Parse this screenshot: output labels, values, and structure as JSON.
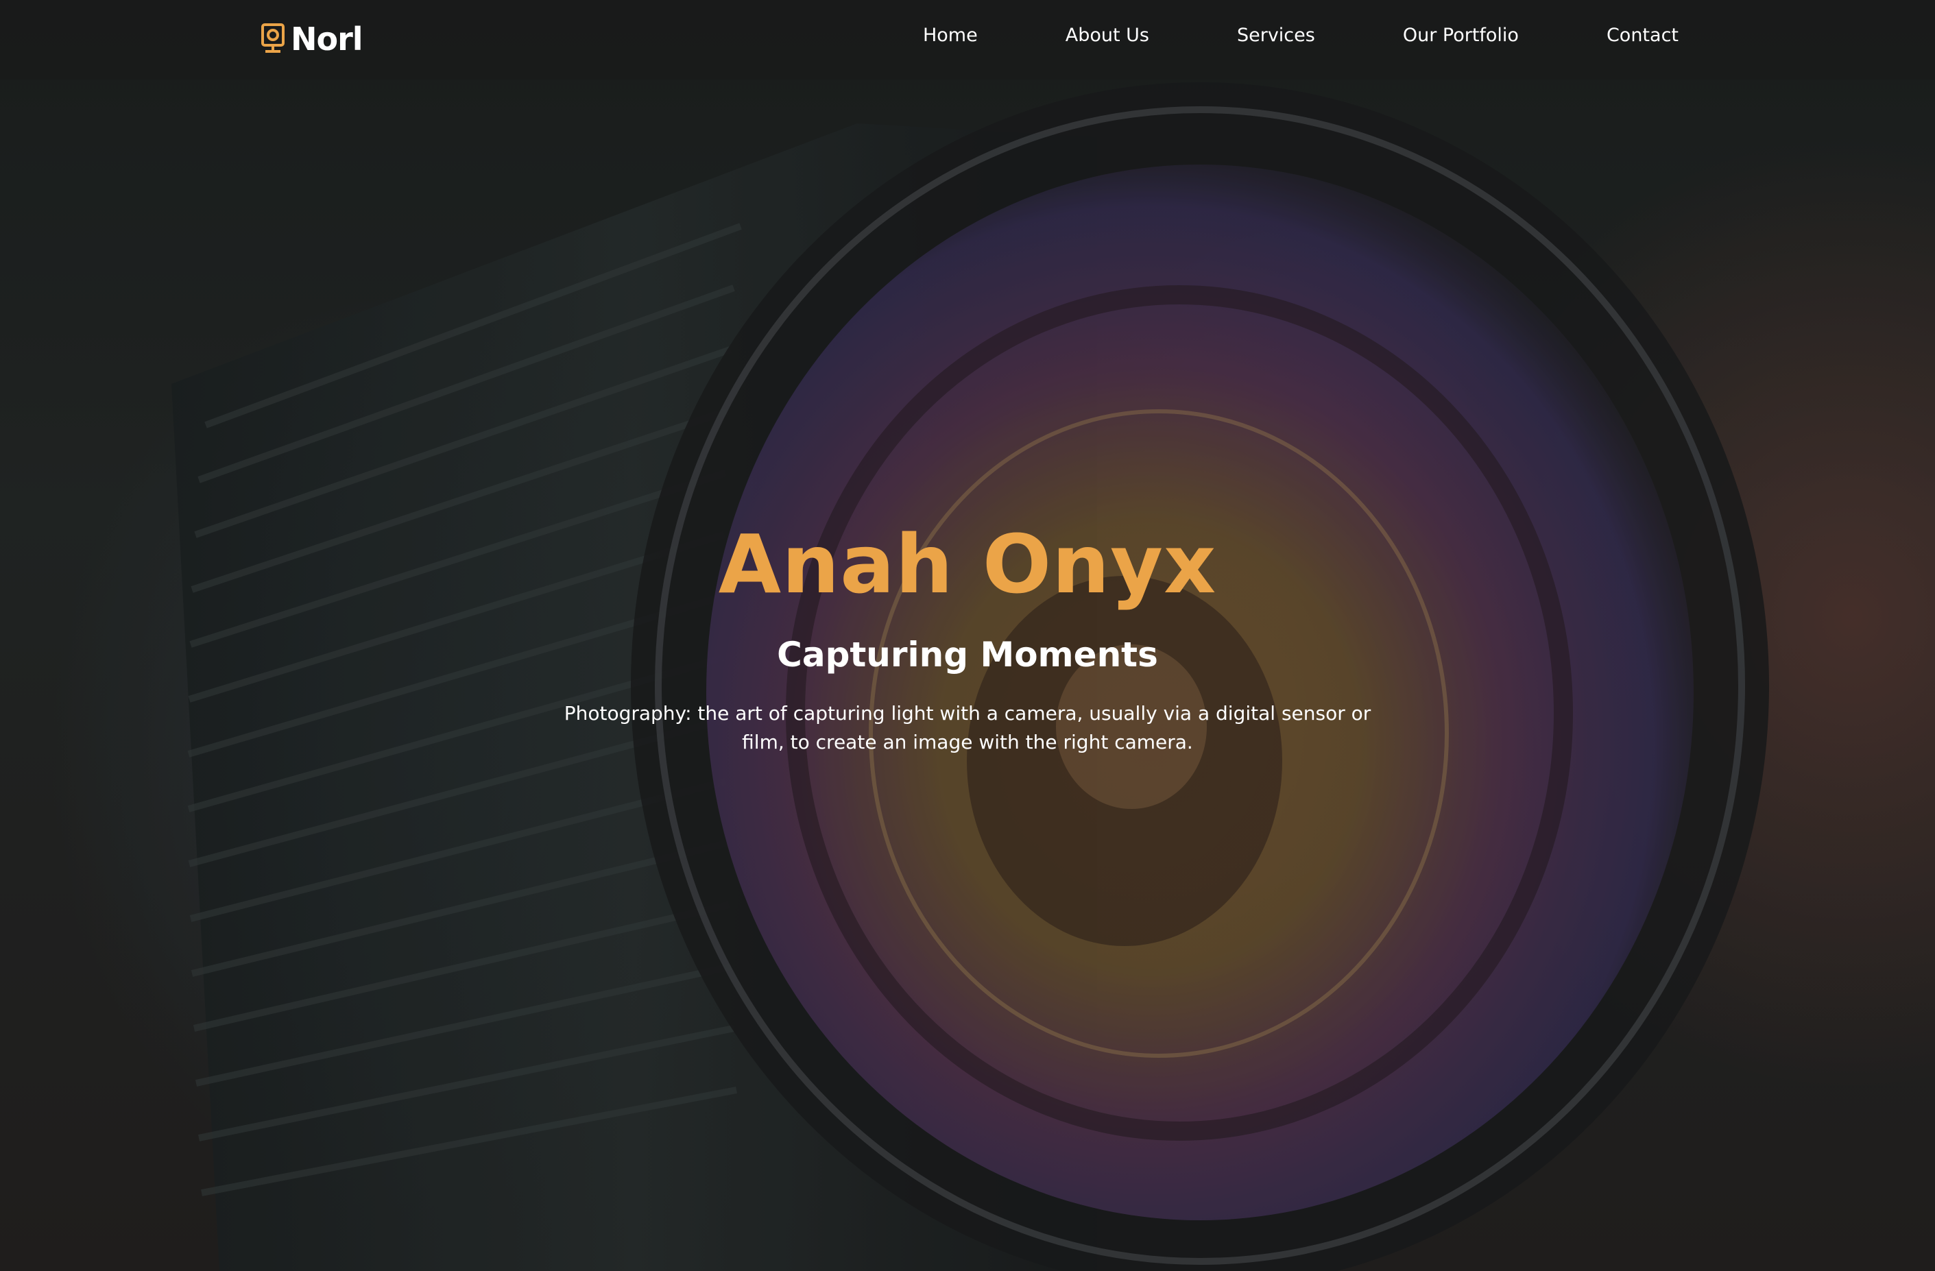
{
  "brand": {
    "name": "Norl",
    "logo_icon": "monitor-camera-icon",
    "accent_color": "#eba448"
  },
  "nav": {
    "items": [
      {
        "label": "Home"
      },
      {
        "label": "About Us"
      },
      {
        "label": "Services"
      },
      {
        "label": "Our Portfolio"
      },
      {
        "label": "Contact"
      }
    ]
  },
  "hero": {
    "title": "Anah Onyx",
    "subtitle": "Capturing Moments",
    "description": "Photography: the art of capturing light with a camera, usually via a digital sensor or film, to create an image with the right camera.",
    "background": "camera-lens-photo"
  }
}
